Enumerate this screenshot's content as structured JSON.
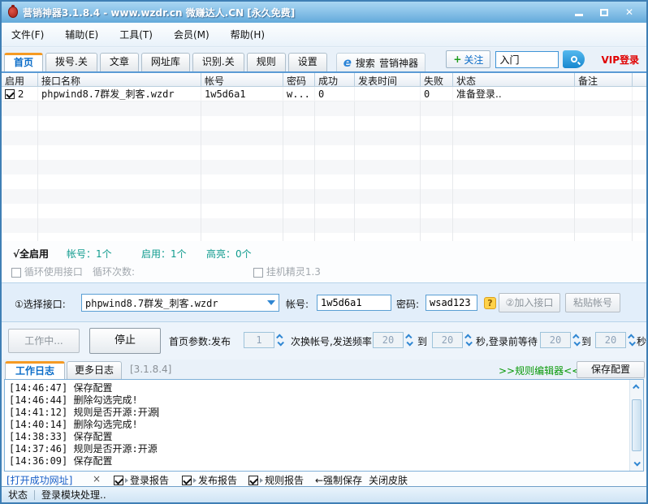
{
  "window": {
    "title": "营销神器3.1.8.4 - www.wzdr.cn 微赚达人.CN [永久免费]"
  },
  "icons": {
    "close": "✕",
    "ie_logo": "e",
    "question": "?"
  },
  "menubar": {
    "items": [
      "文件(F)",
      "辅助(E)",
      "工具(T)",
      "会员(M)",
      "帮助(H)"
    ]
  },
  "tabbar": {
    "tabs": [
      "首页",
      "拨号.关",
      "文章",
      "网址库",
      "识别.关",
      "规则",
      "设置"
    ],
    "active_tab": "首页",
    "search_label": "搜索",
    "search_target": "营销神器",
    "follow_plus": "+",
    "follow_label": "关注",
    "search_input_value": "入门",
    "vip_login": "VIP登录"
  },
  "table": {
    "columns": [
      "启用",
      "接口名称",
      "帐号",
      "密码",
      "成功",
      "发表时间",
      "失败",
      "状态",
      "备注"
    ],
    "rows": [
      {
        "enabled": true,
        "num": "2",
        "name": "phpwind8.7群发_刺客.wzdr",
        "account": "1w5d6a1",
        "password": "w...",
        "success": "0",
        "post_time": "",
        "fail": "0",
        "status": "准备登录..",
        "note": ""
      }
    ]
  },
  "summary": {
    "check": "√",
    "select_all": "全启用",
    "stats": [
      "帐号：1个",
      "启用：1个",
      "高亮：0个"
    ],
    "loop_checkbox": "循环使用接口",
    "loop_count_label": "循环次数:",
    "hangup_checkbox": "挂机精灵1.3"
  },
  "interface_panel": {
    "select_label": "①选择接口:",
    "dropdown_value": "phpwind8.7群发_刺客.wzdr",
    "account_label": "帐号:",
    "account_value": "1w5d6a1",
    "password_label": "密码:",
    "password_value": "wsad123",
    "add_button": "②加入接口",
    "paste_button": "粘贴帐号"
  },
  "control_row": {
    "working_button": "工作中...",
    "stop_button": "停止",
    "params_label": "首页参数:发布",
    "publish_count": "1",
    "label2": "次换帐号,发送频率",
    "freq_from": "20",
    "to1": "到",
    "freq_to": "20",
    "label3": "秒,登录前等待",
    "wait_from": "20",
    "to2": "到",
    "wait_to": "20",
    "label4": "秒"
  },
  "log_section": {
    "tabs": [
      "工作日志",
      "更多日志"
    ],
    "active_tab": "工作日志",
    "version": "[3.1.8.4]",
    "rule_editor_link": ">>规则编辑器<<",
    "save_config_button": "保存配置",
    "lines": [
      "[14:46:47] 保存配置",
      "[14:46:44] 删除勾选完成!",
      "[14:41:12] 规则是否开源:开源",
      "[14:40:14] 删除勾选完成!",
      "[14:38:33] 保存配置",
      "[14:37:46] 规则是否开源:开源",
      "[14:36:09] 保存配置"
    ]
  },
  "bottom_toolbar": {
    "open_urls_link": "[打开成功网址]",
    "close_x": "×",
    "report_checkboxes": [
      "登录报告",
      "发布报告",
      "规则报告"
    ],
    "force_save": "←强制保存",
    "close_skin": "关闭皮肤"
  },
  "statusbar": {
    "label": "状态",
    "message": "登录模块处理.."
  }
}
